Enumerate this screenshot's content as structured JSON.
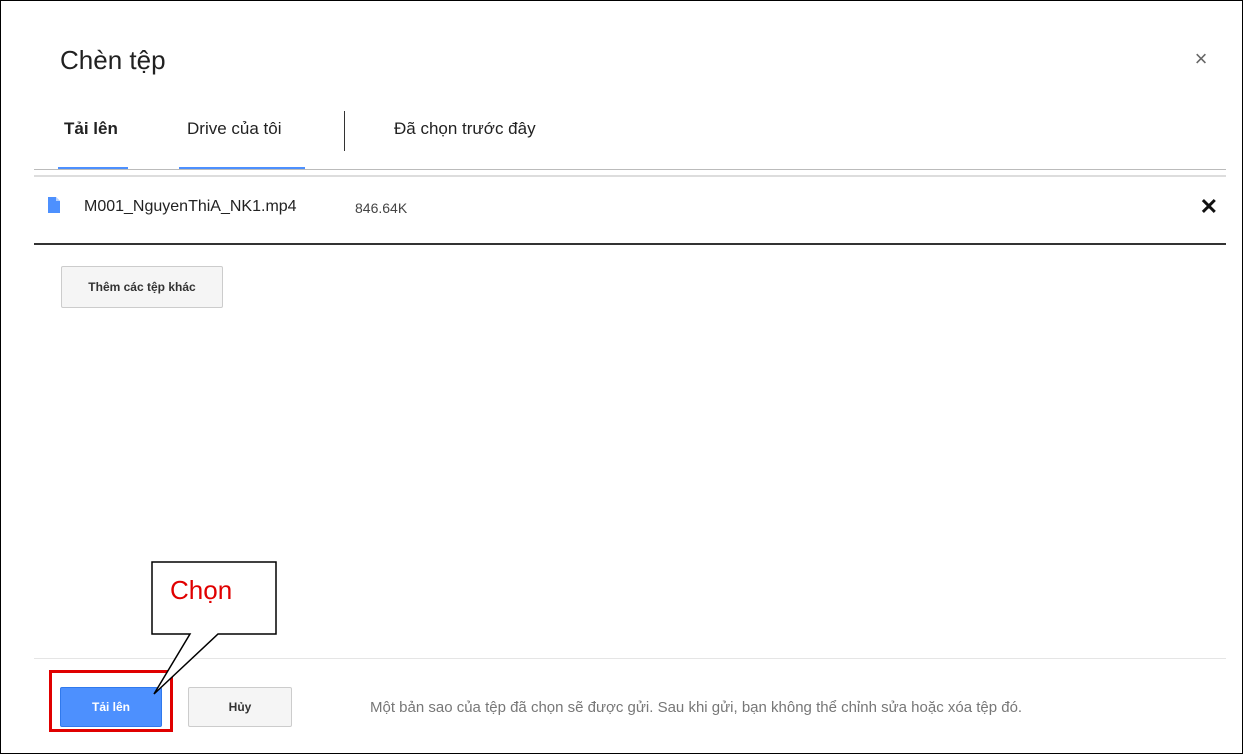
{
  "dialog": {
    "title": "Chèn tệp",
    "close_symbol": "×"
  },
  "tabs": [
    {
      "label": "Tải lên",
      "active": true
    },
    {
      "label": "Drive của tôi",
      "active": false
    },
    {
      "label": "Đã chọn trước đây",
      "active": false
    }
  ],
  "file": {
    "name": "M001_NguyenThiA_NK1.mp4",
    "size": "846.64K",
    "icon": "file-icon",
    "remove_symbol": "✕"
  },
  "actions": {
    "add_more_label": "Thêm các tệp khác",
    "upload_label": "Tải lên",
    "cancel_label": "Hủy"
  },
  "footer": {
    "note": "Một bản sao của tệp đã chọn sẽ được gửi. Sau khi gửi, bạn không thể chỉnh sửa hoặc xóa tệp đó."
  },
  "annotation": {
    "callout_text": "Chọn",
    "color": "#e00000"
  },
  "colors": {
    "accent": "#4d90fe"
  }
}
